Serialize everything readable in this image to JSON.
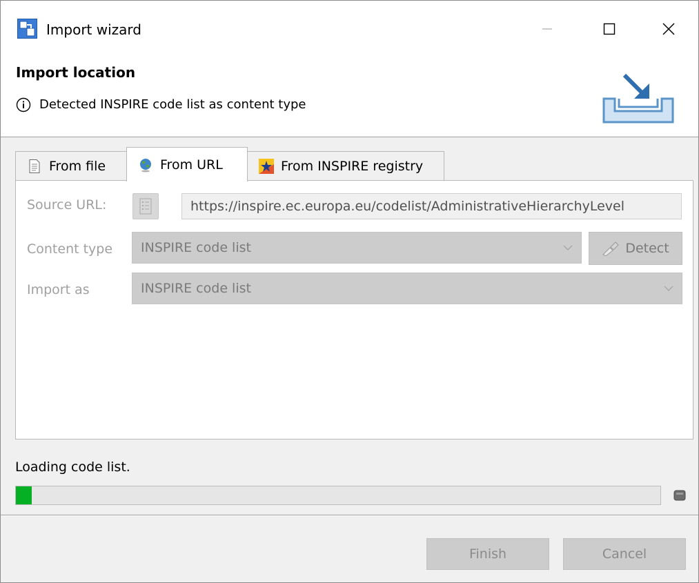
{
  "window": {
    "title": "Import wizard",
    "title_icon": "wizard-icon",
    "minimize_label": "—",
    "maximize_label": "☐",
    "close_label": "✕"
  },
  "header": {
    "title": "Import location",
    "info_icon": "info-icon",
    "info_message": "Detected INSPIRE code list as content type",
    "graphic_icon": "import-tray-icon"
  },
  "tabs": [
    {
      "label": "From file",
      "icon": "file-icon",
      "active": false
    },
    {
      "label": "From URL",
      "icon": "globe-icon",
      "active": true
    },
    {
      "label": "From INSPIRE registry",
      "icon": "eu-star-icon",
      "active": false
    }
  ],
  "form": {
    "source_url_label": "Source URL:",
    "source_url_value": "https://inspire.ec.europa.eu/codelist/AdministrativeHierarchyLevel",
    "content_type_label": "Content type",
    "content_type_value": "INSPIRE code list",
    "detect_label": "Detect",
    "import_as_label": "Import as",
    "import_as_value": "INSPIRE code list"
  },
  "status": {
    "message": "Loading code list.",
    "progress_fraction": 0.025,
    "progress_color": "#06b025"
  },
  "footer": {
    "finish_label": "Finish",
    "cancel_label": "Cancel"
  }
}
